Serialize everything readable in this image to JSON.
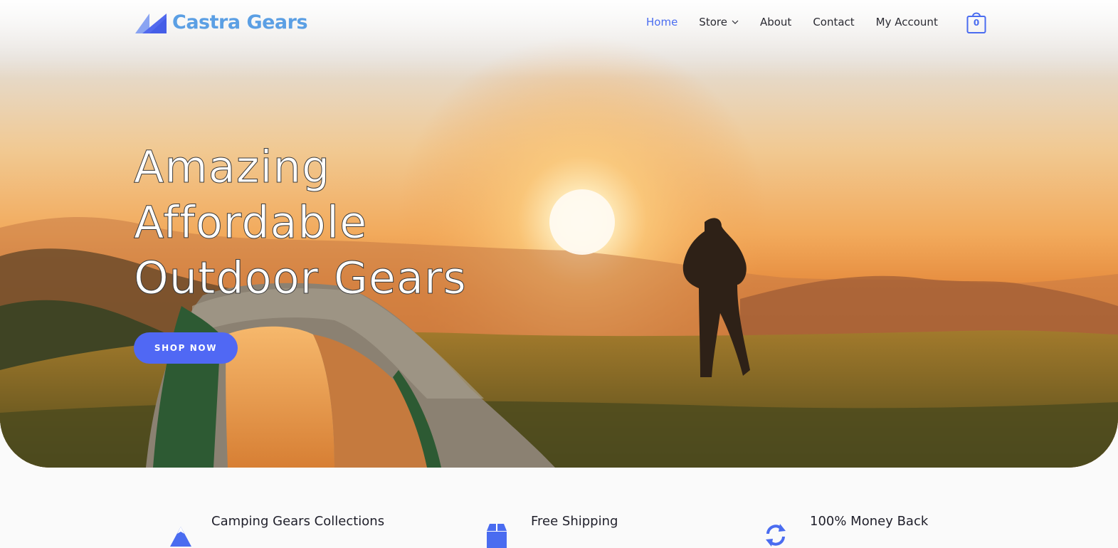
{
  "brand": {
    "name": "Castra Gears",
    "logo_icon": "castra-triangle-logo",
    "color": "#5b9fe4"
  },
  "nav": {
    "items": [
      {
        "label": "Home",
        "active": true
      },
      {
        "label": "Store",
        "dropdown": true
      },
      {
        "label": "About"
      },
      {
        "label": "Contact"
      },
      {
        "label": "My Account"
      }
    ],
    "active_color": "#4a6cf0"
  },
  "cart": {
    "icon": "shopping-bag-icon",
    "count": "0"
  },
  "hero": {
    "headline_lines": [
      "Amazing",
      "Affordable",
      "Outdoor Gears"
    ],
    "cta_label": "SHOP NOW",
    "cta_color": "#5068f4"
  },
  "features": [
    {
      "icon": "mountain-icon",
      "title": "Camping Gears Collections"
    },
    {
      "icon": "box-icon",
      "title": "Free Shipping"
    },
    {
      "icon": "refresh-icon",
      "title": "100% Money Back"
    }
  ]
}
